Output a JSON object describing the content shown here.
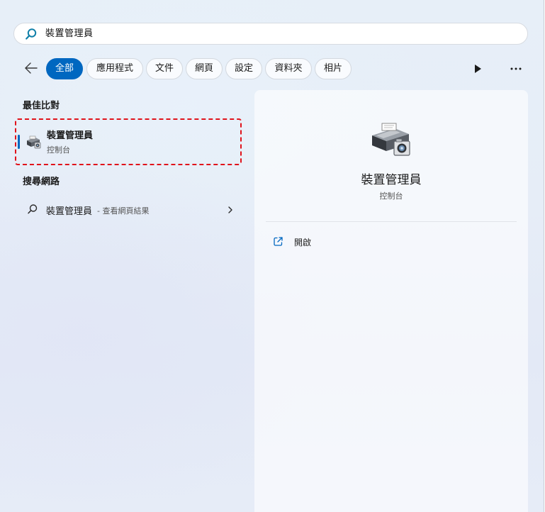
{
  "search": {
    "query": "裝置管理員"
  },
  "filters": {
    "tabs": [
      {
        "label": "全部",
        "active": true
      },
      {
        "label": "應用程式",
        "active": false
      },
      {
        "label": "文件",
        "active": false
      },
      {
        "label": "網頁",
        "active": false
      },
      {
        "label": "設定",
        "active": false
      },
      {
        "label": "資料夾",
        "active": false
      },
      {
        "label": "相片",
        "active": false
      }
    ]
  },
  "best_match": {
    "section_title": "最佳比對",
    "title": "裝置管理員",
    "subtitle": "控制台",
    "icon": "device-manager-icon"
  },
  "web_search": {
    "section_title": "搜尋網路",
    "query": "裝置管理員",
    "hint": "- 查看網頁結果"
  },
  "detail": {
    "title": "裝置管理員",
    "subtitle": "控制台",
    "actions": [
      {
        "label": "開啟",
        "icon": "open-external-icon"
      }
    ]
  },
  "colors": {
    "accent": "#0067c0",
    "highlight_border": "#e0131b",
    "search_icon": "#0f7fa8"
  }
}
